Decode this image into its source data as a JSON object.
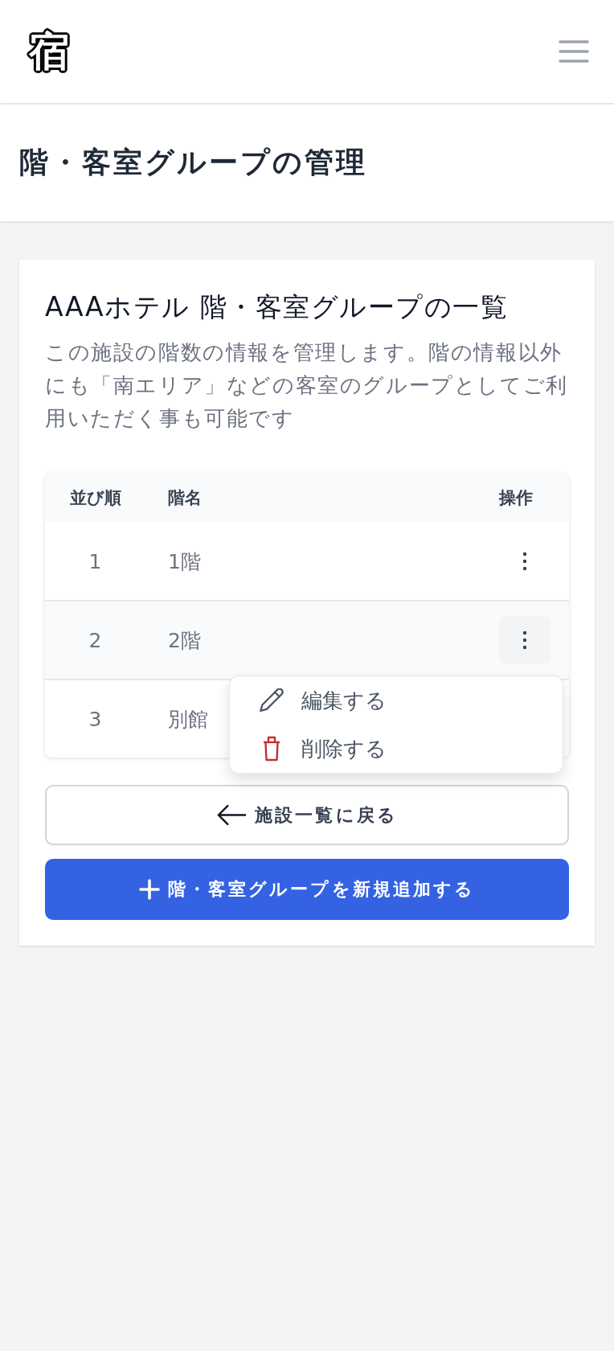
{
  "header": {
    "logo": "宿"
  },
  "page_title": "階・客室グループの管理",
  "card": {
    "title": "AAAホテル 階・客室グループの一覧",
    "description": "この施設の階数の情報を管理します。階の情報以外にも「南エリア」などの客室のグループとしてご利用いただく事も可能です"
  },
  "table": {
    "columns": [
      "並び順",
      "階名",
      "操作"
    ],
    "rows": [
      {
        "order": "1",
        "name": "1階"
      },
      {
        "order": "2",
        "name": "2階",
        "menu": [
          {
            "kind": "edit",
            "label": "編集する"
          },
          {
            "kind": "delete",
            "label": "削除する"
          }
        ]
      },
      {
        "order": "3",
        "name": "別館"
      }
    ]
  },
  "buttons": [
    {
      "kind": "back",
      "label": "施設一覧に戻る"
    },
    {
      "kind": "add",
      "label": "階・客室グループを新規追加する"
    }
  ]
}
